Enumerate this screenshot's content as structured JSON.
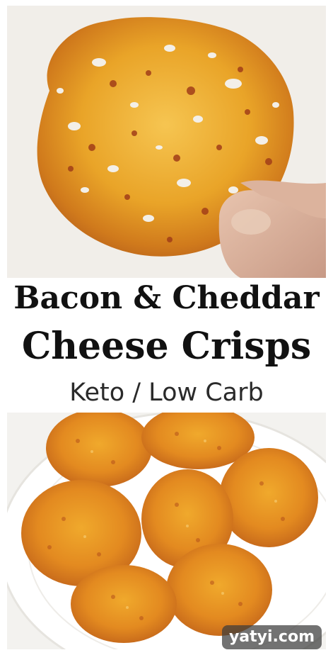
{
  "title_line1": "Bacon & Cheddar",
  "title_line2": "Cheese Crisps",
  "subtitle": "Keto / Low Carb",
  "watermark": "yatyi.com",
  "colors": {
    "cheese_light": "#f2b53a",
    "cheese_mid": "#e39a22",
    "cheese_dark": "#c9681a",
    "bacon": "#9c3a18",
    "plate": "#ffffff",
    "text": "#111111"
  }
}
